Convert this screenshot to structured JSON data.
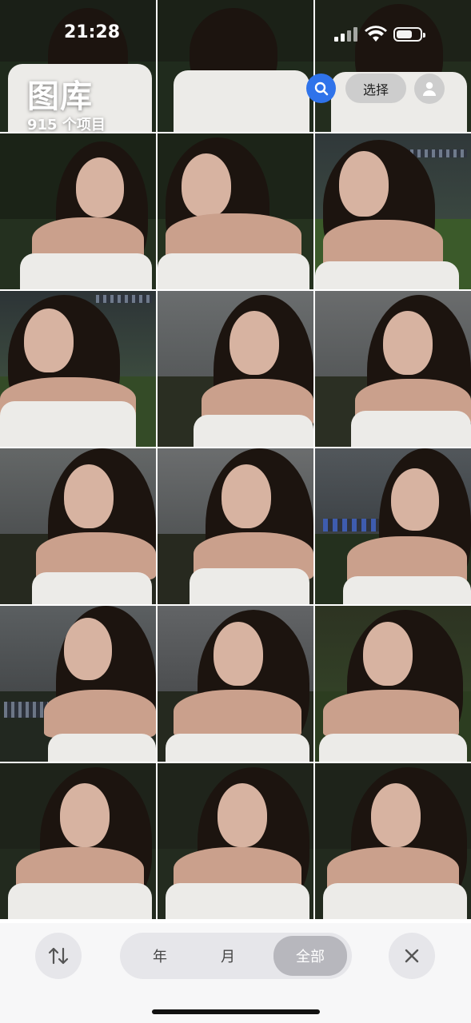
{
  "status_bar": {
    "time": "21:28"
  },
  "header": {
    "title": "图库",
    "count": "915 个项目",
    "select_label": "选择"
  },
  "icons": {
    "search": "search-icon",
    "account": "person-icon",
    "sort": "sort-arrows-icon",
    "close": "close-icon"
  },
  "colors": {
    "accent": "#2f73ea"
  },
  "bottom_bar": {
    "segments": [
      "年",
      "月",
      "全部"
    ],
    "selected": "全部"
  }
}
